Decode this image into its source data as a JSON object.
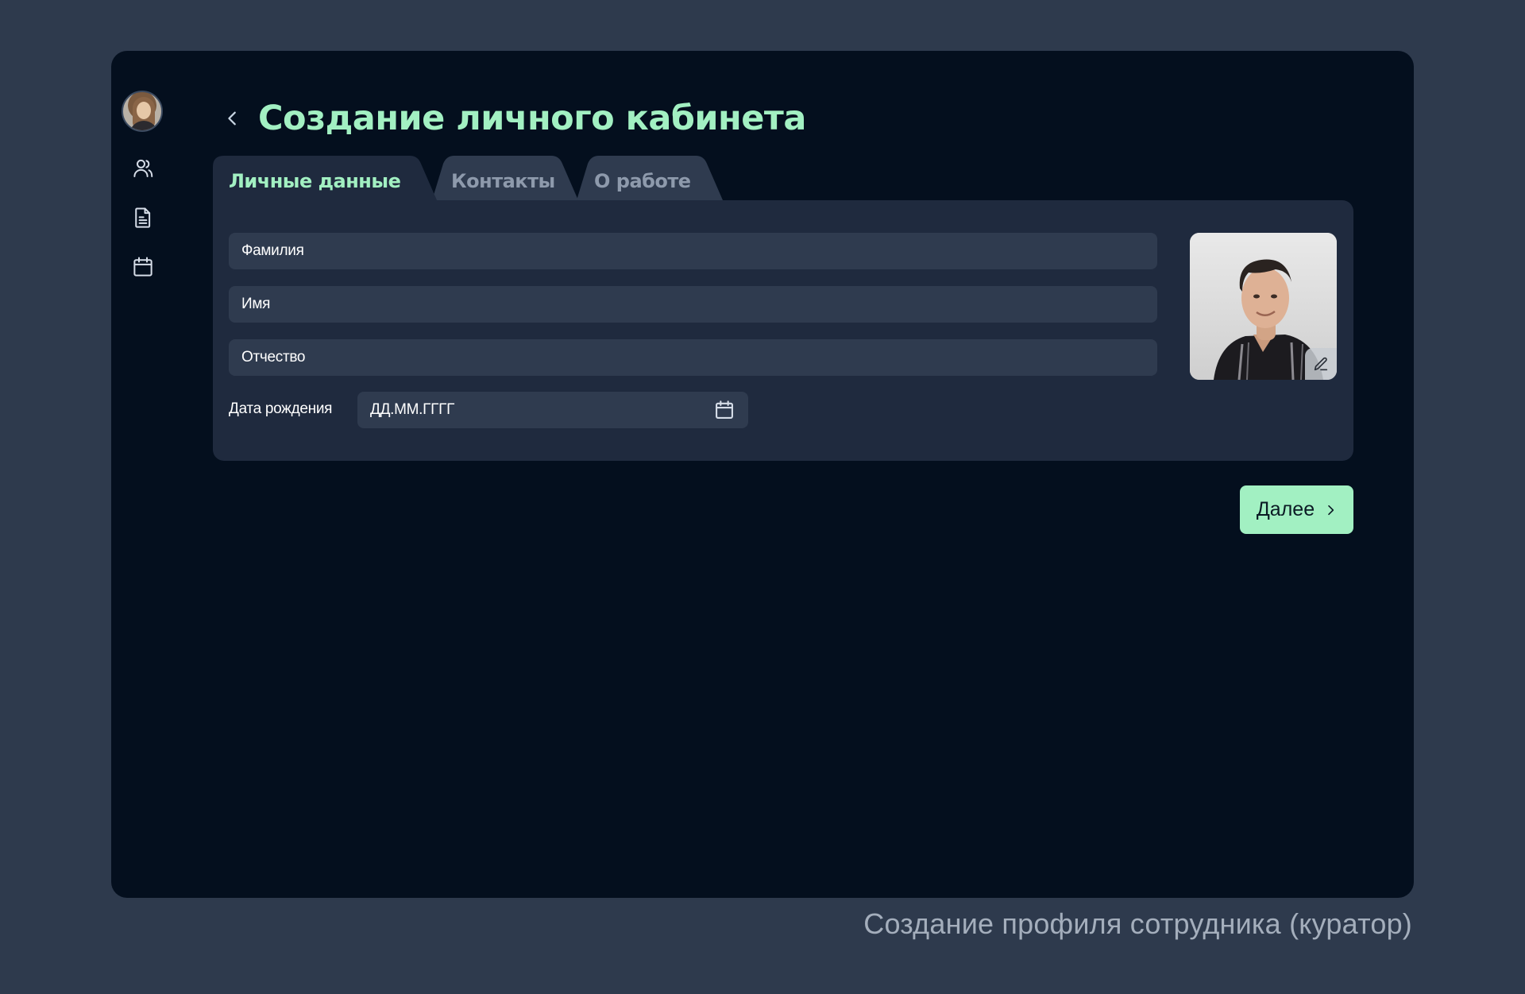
{
  "page": {
    "title": "Создание личного кабинета",
    "caption": "Создание профиля сотрудника (куратор)"
  },
  "sidebar": {
    "items": [
      {
        "icon": "users-icon"
      },
      {
        "icon": "document-icon"
      },
      {
        "icon": "calendar-icon"
      }
    ]
  },
  "tabs": [
    {
      "label": "Личные данные",
      "active": true
    },
    {
      "label": "Контакты",
      "active": false
    },
    {
      "label": "О работе",
      "active": false
    }
  ],
  "form": {
    "lastname_placeholder": "Фамилия",
    "firstname_placeholder": "Имя",
    "patronymic_placeholder": "Отчество",
    "dob_label": "Дата рождения",
    "dob_placeholder": "ДД.ММ.ГГГГ"
  },
  "actions": {
    "next_label": "Далее"
  },
  "colors": {
    "accent": "#a2f0c2",
    "background": "#2e3a4d",
    "window": "#040f1e",
    "panel": "#1f2a3e",
    "field": "#2f3b4f"
  }
}
